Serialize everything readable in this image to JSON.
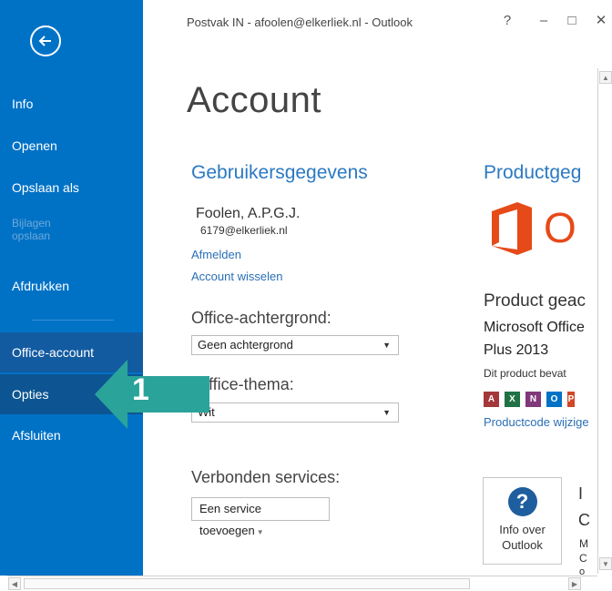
{
  "window": {
    "title": "Postvak IN - afoolen@elkerliek.nl - Outlook",
    "help_label": "?",
    "minimize_label": "–",
    "maximize_label": "□",
    "close_label": "✕"
  },
  "nav": {
    "back_icon": "back-arrow-icon",
    "items": [
      {
        "label": "Info"
      },
      {
        "label": "Openen"
      },
      {
        "label": "Opslaan als"
      },
      {
        "label_line1": "Bijlagen",
        "label_line2": "opslaan"
      },
      {
        "label": "Afdrukken"
      },
      {
        "label": "Office-account"
      },
      {
        "label": "Opties"
      },
      {
        "label": "Afsluiten"
      }
    ],
    "bg_color": "#0072c6"
  },
  "account": {
    "title": "Account",
    "user_section_title": "Gebruikersgegevens",
    "user_name": "Foolen, A.P.G.J.",
    "user_email": "6179@elkerliek.nl",
    "signout_link": "Afmelden",
    "switch_link": "Account wisselen",
    "background_label": "Office-achtergrond:",
    "background_value": "Geen achtergrond",
    "theme_label": "ffice-thema:",
    "theme_value": "Wit",
    "services_label": "Verbonden services:",
    "add_service_label": "Een service toevoegen"
  },
  "product": {
    "section_title": "Productgeg",
    "logo_text": "O",
    "heading": "Product geac",
    "name_line1": "Microsoft Office",
    "name_line2": "Plus 2013",
    "contains": "Dit product bevat",
    "apps": [
      {
        "letter": "A",
        "color": "#a4373a"
      },
      {
        "letter": "X",
        "color": "#207245"
      },
      {
        "letter": "N",
        "color": "#80397b"
      },
      {
        "letter": "O",
        "color": "#0072c6"
      },
      {
        "letter": "P",
        "color": "#d24726"
      }
    ],
    "productcode_link": "Productcode wijzige",
    "info_button_line1": "Info over",
    "info_button_line2": "Outlook",
    "info_icon": "question-icon",
    "clip_1": "I",
    "clip_2": "C",
    "clip_3": "M",
    "clip_4": "C",
    "clip_5": "o"
  },
  "annotation": {
    "number": "1",
    "color": "#2aa39a"
  }
}
